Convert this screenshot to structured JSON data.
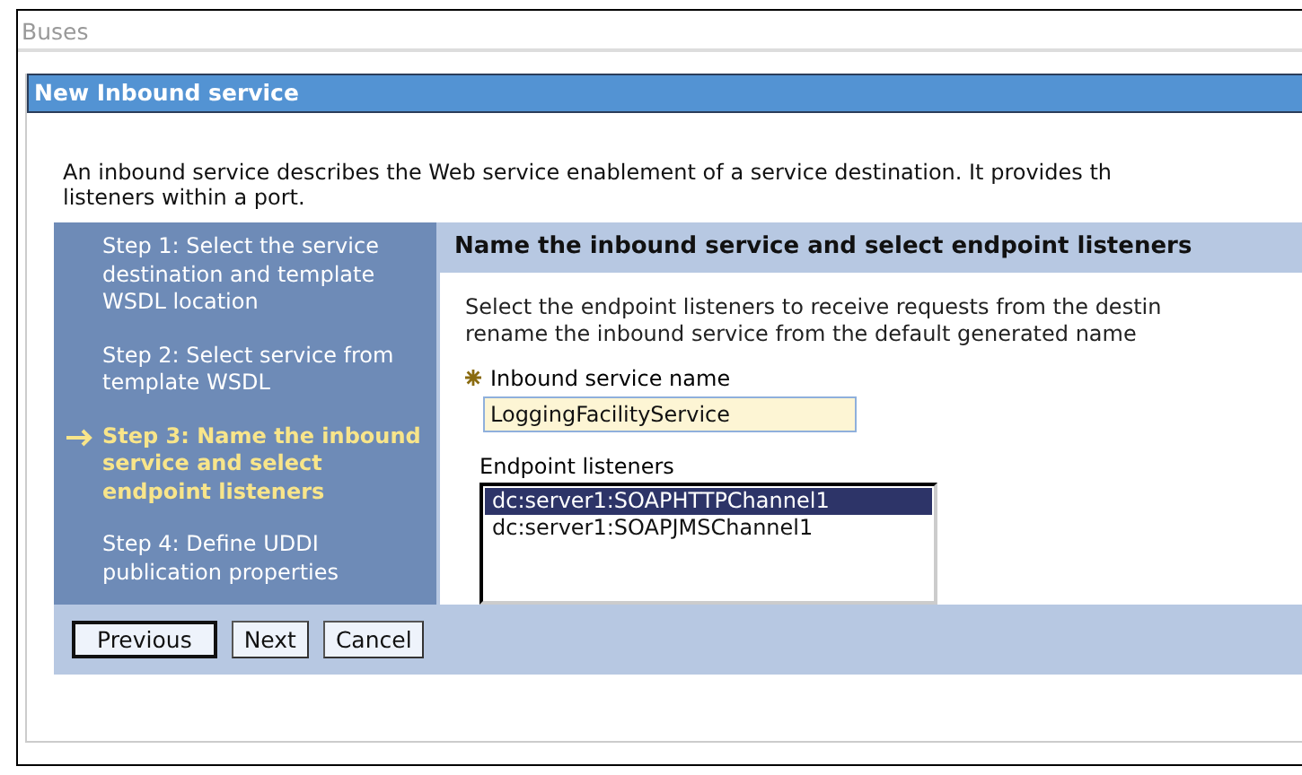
{
  "breadcrumb": "Buses",
  "dialog": {
    "title": "New Inbound service",
    "description": "An inbound service describes the Web service enablement of a service destination. It provides th\nlisteners within a port.",
    "steps": [
      {
        "label": "Step 1: Select the service destination and template WSDL location",
        "selected": false
      },
      {
        "label": "Step 2: Select service from template WSDL",
        "selected": false
      },
      {
        "label": "Step 3: Name the inbound service and select endpoint listeners",
        "selected": true
      },
      {
        "label": "Step 4: Define UDDI publication properties",
        "selected": false
      }
    ],
    "panel": {
      "heading": "Name the inbound service and select endpoint listeners",
      "instructions": "Select the endpoint listeners to receive requests from the destin\nrename the inbound service from the default generated name",
      "name_field": {
        "label": "Inbound service name",
        "required": true,
        "value": "LoggingFacilityService"
      },
      "listeners": {
        "label": "Endpoint listeners",
        "items": [
          {
            "label": "dc:server1:SOAPHTTPChannel1",
            "selected": true
          },
          {
            "label": "dc:server1:SOAPJMSChannel1",
            "selected": false
          }
        ]
      }
    },
    "buttons": [
      {
        "label": "Previous",
        "default": true
      },
      {
        "label": "Next",
        "default": false
      },
      {
        "label": "Cancel",
        "default": false
      }
    ]
  }
}
